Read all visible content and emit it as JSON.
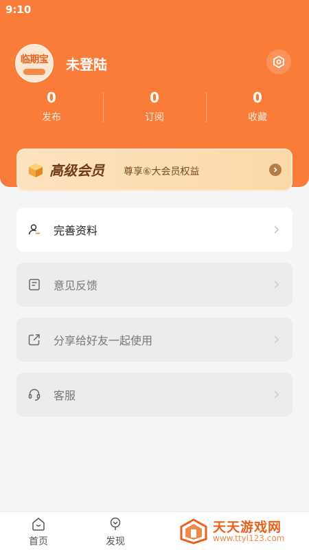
{
  "status_bar": {
    "time": "9:10"
  },
  "profile": {
    "avatar_text": "临期宝",
    "username": "未登陆"
  },
  "stats": [
    {
      "value": "0",
      "label": "发布"
    },
    {
      "value": "0",
      "label": "订阅"
    },
    {
      "value": "0",
      "label": "收藏"
    }
  ],
  "vip": {
    "title": "高级会员",
    "desc": "尊享⑥大会员权益"
  },
  "menu": [
    {
      "label": "完善资料",
      "icon": "user-edit-icon"
    },
    {
      "label": "意见反馈",
      "icon": "feedback-icon"
    },
    {
      "label": "分享给好友一起使用",
      "icon": "share-icon"
    },
    {
      "label": "客服",
      "icon": "headset-icon"
    }
  ],
  "tabs": [
    {
      "label": "首页",
      "icon": "home-icon"
    },
    {
      "label": "发现",
      "icon": "discover-icon"
    }
  ],
  "watermark": {
    "title": "天天游戏网",
    "url": "www.ttyl123.com"
  },
  "colors": {
    "primary": "#f97c38",
    "vip_bg": "#fde2bf",
    "vip_text": "#6b3a16"
  }
}
